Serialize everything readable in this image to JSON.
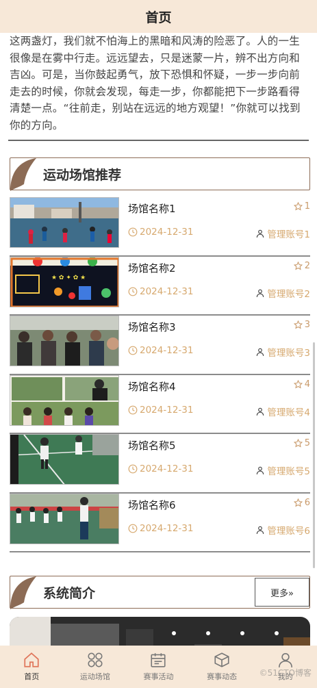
{
  "header": {
    "title": "首页"
  },
  "intro": {
    "text": "这两盏灯，我们就不怕海上的黑暗和风涛的险恶了。人的一生很像是在雾中行走。远远望去，只是迷蒙一片，辨不出方向和吉凶。可是，当你鼓起勇气，放下恐惧和怀疑，一步一步向前走去的时候，你就会发现，每走一步，你都能把下一步路看得清楚一点。“往前走，别站在远远的地方观望！”你就可以找到你的方向。"
  },
  "venues_section": {
    "title": "运动场馆推荐"
  },
  "venues": [
    {
      "name": "场馆名称1",
      "favorites": "1",
      "date": "2024-12-31",
      "owner": "管理账号1"
    },
    {
      "name": "场馆名称2",
      "favorites": "2",
      "date": "2024-12-31",
      "owner": "管理账号2"
    },
    {
      "name": "场馆名称3",
      "favorites": "3",
      "date": "2024-12-31",
      "owner": "管理账号3"
    },
    {
      "name": "场馆名称4",
      "favorites": "4",
      "date": "2024-12-31",
      "owner": "管理账号4"
    },
    {
      "name": "场馆名称5",
      "favorites": "5",
      "date": "2024-12-31",
      "owner": "管理账号5"
    },
    {
      "name": "场馆名称6",
      "favorites": "6",
      "date": "2024-12-31",
      "owner": "管理账号6"
    }
  ],
  "about_section": {
    "title": "系统简介",
    "more_label": "更多»"
  },
  "tabbar": {
    "items": [
      {
        "label": "首页",
        "icon": "home-icon",
        "active": true
      },
      {
        "label": "运动场馆",
        "icon": "grid-icon",
        "active": false
      },
      {
        "label": "赛事活动",
        "icon": "calendar-icon",
        "active": false
      },
      {
        "label": "赛事动态",
        "icon": "box-icon",
        "active": false
      },
      {
        "label": "我的",
        "icon": "user-icon",
        "active": false
      }
    ]
  },
  "watermark": "©51CTO博客",
  "colors": {
    "accent": "#d6a86e",
    "header_bg": "#f7e8d8",
    "leaf": "#8c6b55"
  }
}
